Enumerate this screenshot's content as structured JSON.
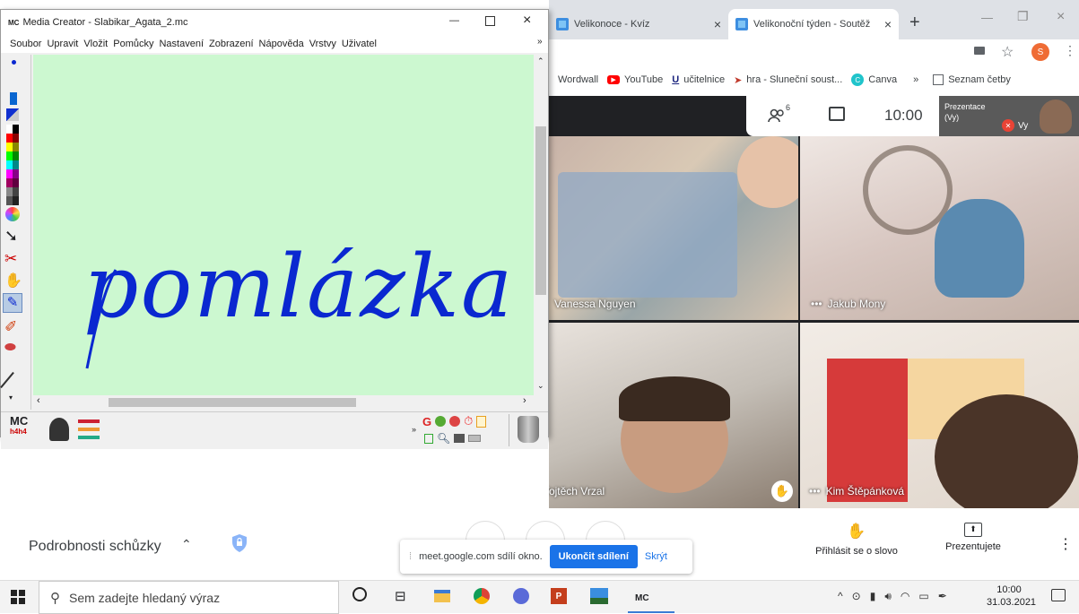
{
  "media_creator": {
    "title": "Media Creator - Slabikar_Agata_2.mc",
    "app_badge": "MC",
    "menu": [
      "Soubor",
      "Upravit",
      "Vložit",
      "Pomůcky",
      "Nastavení",
      "Zobrazení",
      "Nápověda",
      "Vrstvy",
      "Uživatel"
    ],
    "overflow": "»",
    "canvas_word": "pomlázka",
    "ink_color": "#0a28d0",
    "canvas_color": "#ccf8d0",
    "logo_text": "MC",
    "logo_sub": "h4h4",
    "tool_letter": "G"
  },
  "browser": {
    "tabs": [
      {
        "label": "Velikonoce - Kvíz"
      },
      {
        "label": "Velikonoční týden - Soutěž"
      }
    ],
    "new_tab": "+",
    "profile_initial": "S",
    "bookmarks": [
      "Wordwall",
      "YouTube",
      "učitelnice",
      "hra - Sluneční soust...",
      "Canva"
    ],
    "bookmark_more": "»",
    "reading_list": "Seznam četby"
  },
  "meet": {
    "top": {
      "people_count": "6",
      "time": "10:00",
      "presenting_label": "Prezentace (Vy)",
      "self_name": "Vy"
    },
    "participants": [
      {
        "name": "Vanessa Nguyen"
      },
      {
        "name": "Jakub Mony"
      },
      {
        "name": "Vojtěch Vrzal"
      },
      {
        "name": "Kim Štěpánková"
      }
    ],
    "meeting_details": "Podrobnosti schůzky",
    "share_text": "meet.google.com sdílí okno.",
    "stop_share": "Ukončit sdílení",
    "hide": "Skrýt",
    "raise_hand": "Přihlásit se o slovo",
    "presenting": "Prezentujete",
    "accent": "#1a73e8"
  },
  "taskbar": {
    "search_placeholder": "Sem zadejte hledaný výraz",
    "time": "10:00",
    "date": "31.03.2021",
    "mc_label": "MC"
  }
}
